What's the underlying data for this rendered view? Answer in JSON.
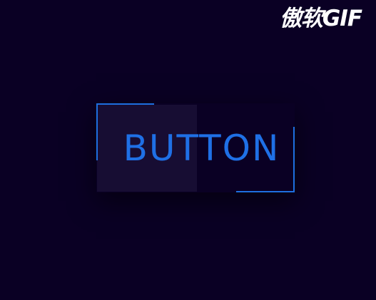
{
  "watermark": {
    "text": "傲软GIF"
  },
  "button": {
    "label": "BUTTON"
  },
  "colors": {
    "background": "#0a0024",
    "accent": "#1e6fe0",
    "button_highlight": "#170d33",
    "watermark": "#ffffff"
  }
}
